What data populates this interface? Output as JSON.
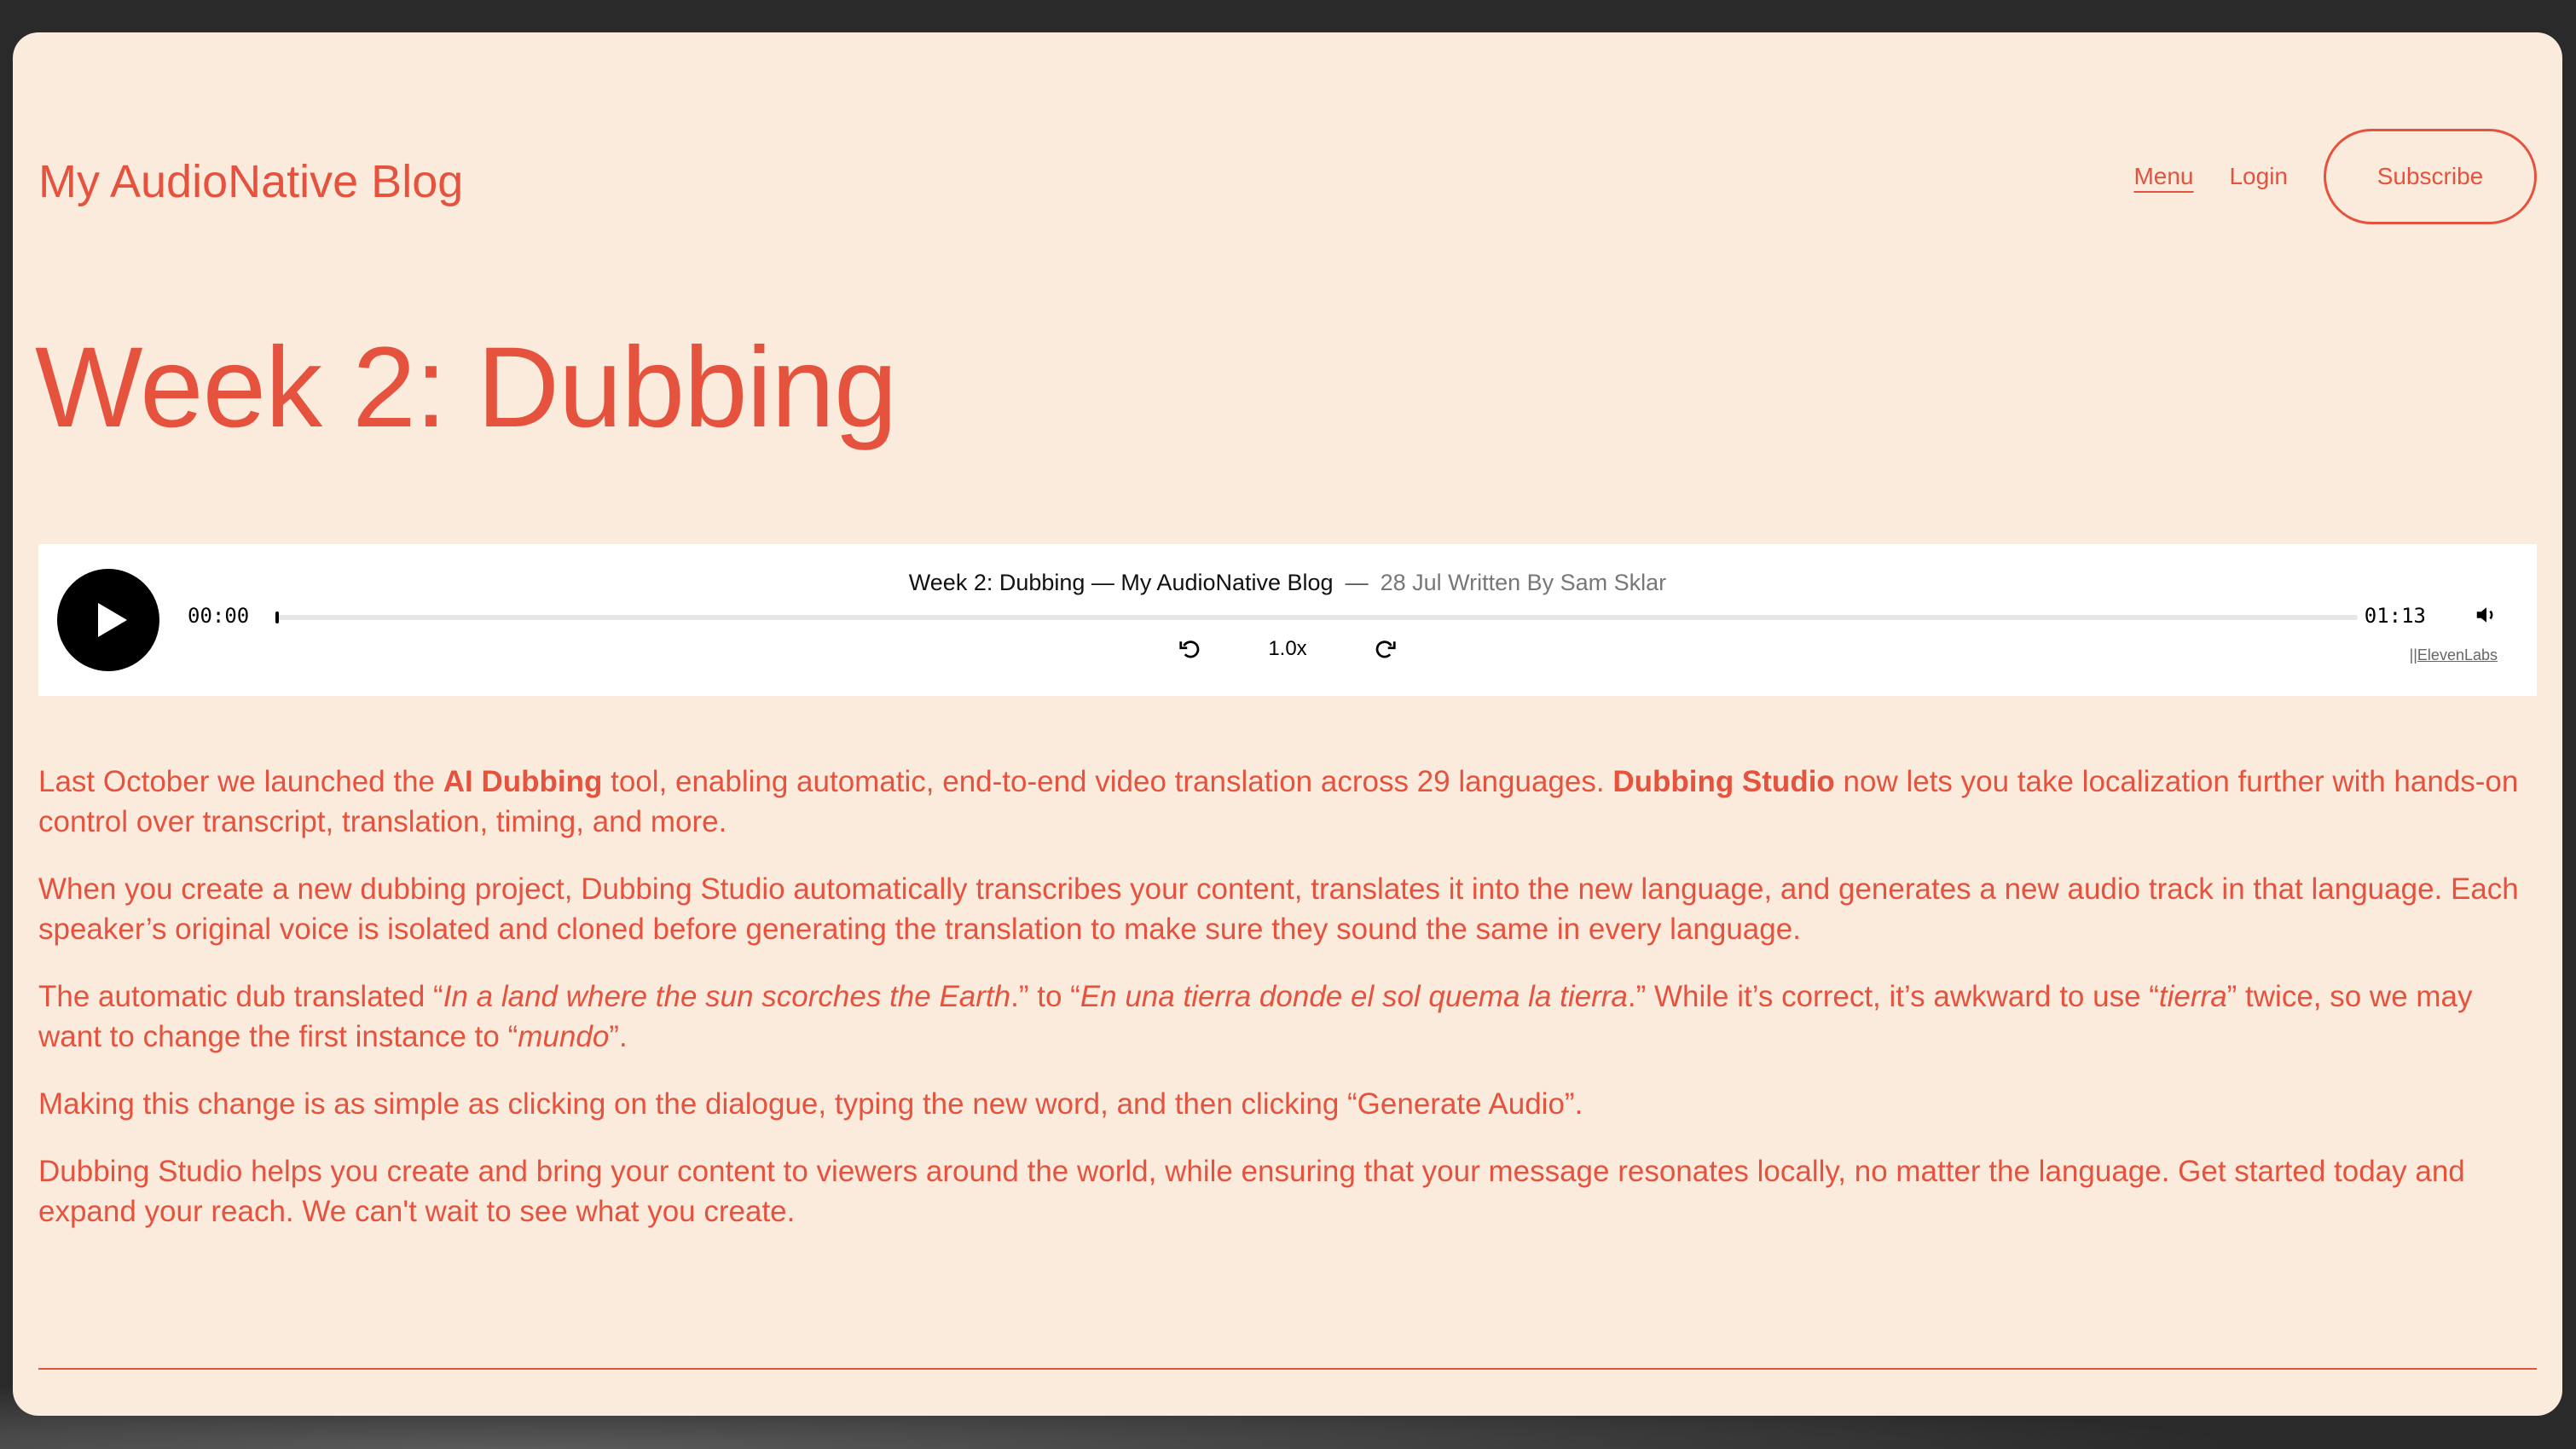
{
  "header": {
    "brand": "My AudioNative Blog",
    "nav": {
      "menu": "Menu",
      "login": "Login",
      "subscribe": "Subscribe"
    }
  },
  "post": {
    "title": "Week 2: Dubbing"
  },
  "player": {
    "title": "Week 2: Dubbing — My AudioNative Blog",
    "separator": "—",
    "meta": "28 Jul Written By Sam Sklar",
    "current_time": "00:00",
    "total_time": "01:13",
    "speed": "1.0x",
    "progress_fraction": 0,
    "brandmark": "||ElevenLabs",
    "icons": [
      "play-icon",
      "rewind-icon",
      "forward-icon",
      "volume-icon"
    ]
  },
  "article": {
    "p1": {
      "a": "Last October we launched the ",
      "b": "AI Dubbing",
      "c": " tool, enabling automatic, end-to-end video translation across 29 languages. ",
      "d": "Dubbing Studio",
      "e": " now lets you take localization further with hands-on control over transcript, translation, timing, and more."
    },
    "p2": "When you create a new dubbing project, Dubbing Studio automatically transcribes your content, translates it into the new language, and generates a new audio track in that language. Each speaker’s original voice is isolated and cloned before generating the translation to make sure they sound the same in every language.",
    "p3": {
      "a": "The automatic dub translated “",
      "b": "In a land where the sun scorches the Earth",
      "c": ".” to “",
      "d": "En una tierra donde el sol quema la tierra",
      "e": ".” While it’s correct, it’s awkward to use “",
      "f": "tierra",
      "g": "” twice, so we may want to change the first instance to “",
      "h": "mundo",
      "i": "”."
    },
    "p4": "Making this change is as simple as clicking on the dialogue, typing the new word, and then clicking “Generate Audio”.",
    "p5": "Dubbing Studio helps you create and bring your content to viewers around the world, while ensuring that your message resonates locally, no matter the language. Get started today and expand your reach. We can't wait to see what you create."
  },
  "colors": {
    "accent": "#e5533f",
    "page_bg": "#faebdd",
    "backdrop": "#2a2a2a"
  }
}
